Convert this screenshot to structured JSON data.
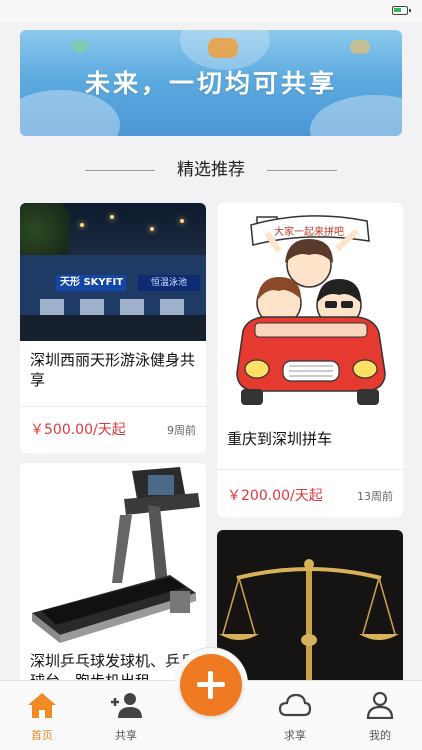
{
  "status_bar": {
    "battery_level": 0.6,
    "battery_color": "#2fbf4d"
  },
  "banner": {
    "text": "未来，一切均可共享"
  },
  "section": {
    "title": "精选推荐"
  },
  "cards": [
    {
      "title": "深圳西丽天形游泳健身共享",
      "price": "￥500.00/天起",
      "time": "9周前",
      "image_sign": "天形 SKYFIT",
      "image_sign2": "恒温泳池"
    },
    {
      "title": "重庆到深圳拼车",
      "price": "￥200.00/天起",
      "time": "13周前",
      "image_banner": "大家一起来拼吧"
    },
    {
      "title": "深圳乒乓球发球机、乒乓球台，跑步机出租"
    },
    {
      "title": ""
    }
  ],
  "tabbar": {
    "tabs": [
      {
        "label": "首页",
        "icon": "home-icon",
        "active": true
      },
      {
        "label": "共享",
        "icon": "add-user-icon",
        "active": false
      },
      {
        "label": "求享",
        "icon": "cloud-icon",
        "active": false
      },
      {
        "label": "我的",
        "icon": "user-icon",
        "active": false
      }
    ],
    "fab_icon": "plus-icon"
  },
  "colors": {
    "accent": "#f07a22",
    "price": "#e0393e",
    "active_tab": "#f08a24"
  }
}
